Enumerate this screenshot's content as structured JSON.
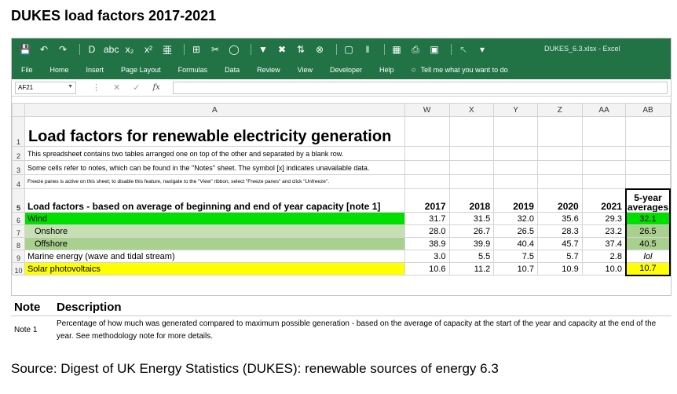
{
  "page_title": "DUKES load factors 2017-2021",
  "excel": {
    "window_title": "DUKES_6.3.xlsx  -  Excel",
    "menu": [
      "File",
      "Home",
      "Insert",
      "Page Layout",
      "Formulas",
      "Data",
      "Review",
      "View",
      "Developer",
      "Help"
    ],
    "tell_me": "Tell me what you want to do",
    "name_box": "AF21",
    "fx_label": "fx",
    "columns": [
      "A",
      "W",
      "X",
      "Y",
      "Z",
      "AA",
      "AB"
    ],
    "row_numbers": [
      "1",
      "2",
      "3",
      "4",
      "5",
      "6",
      "7",
      "8",
      "9",
      "10"
    ],
    "sheet_title": "Load factors for renewable electricity generation",
    "note_row2": "This spreadsheet contains two tables arranged one on top of the other and separated by a blank row.",
    "note_row3": "Some cells refer to notes, which can be found in the \"Notes\" sheet. The symbol [x] indicates unavailable data.",
    "note_row4": "Freeze panes is active on this sheet; to disable this feature, navigate to the \"View\" ribbon, select \"Freeze panes\" and click \"Unfreeze\".",
    "table_header": "Load factors - based on average of beginning and end of year capacity [note 1]",
    "years": [
      "2017",
      "2018",
      "2019",
      "2020",
      "2021"
    ],
    "avg_header_line1": "5-year",
    "avg_header_line2": "averages",
    "rows": [
      {
        "label": "Wind",
        "values": [
          "31.7",
          "31.5",
          "32.0",
          "35.6",
          "29.3"
        ],
        "avg": "32.1",
        "color": "#00e000"
      },
      {
        "label": "Onshore",
        "values": [
          "28.0",
          "26.7",
          "26.5",
          "28.3",
          "23.2"
        ],
        "avg": "26.5",
        "color": "#c6e0b4"
      },
      {
        "label": "Offshore",
        "values": [
          "38.9",
          "39.9",
          "40.4",
          "45.7",
          "37.4"
        ],
        "avg": "40.5",
        "color": "#a9d08e"
      },
      {
        "label": "Marine energy (wave and tidal stream)",
        "values": [
          "3.0",
          "5.5",
          "7.5",
          "5.7",
          "2.8"
        ],
        "avg": "lol",
        "color": "#ffffff"
      },
      {
        "label": "Solar photovoltaics",
        "values": [
          "10.6",
          "11.2",
          "10.7",
          "10.9",
          "10.0"
        ],
        "avg": "10.7",
        "color": "#ffff00"
      }
    ]
  },
  "notes": {
    "col_note": "Note",
    "col_desc": "Description",
    "items": [
      {
        "note": "Note 1",
        "description": "Percentage of how much was generated compared to maximum possible generation - based on the average of capacity at the start of the year and capacity at the end of the year. See methodology note for more details."
      }
    ]
  },
  "source": "Source: Digest of UK Energy Statistics (DUKES): renewable sources of energy 6.3"
}
